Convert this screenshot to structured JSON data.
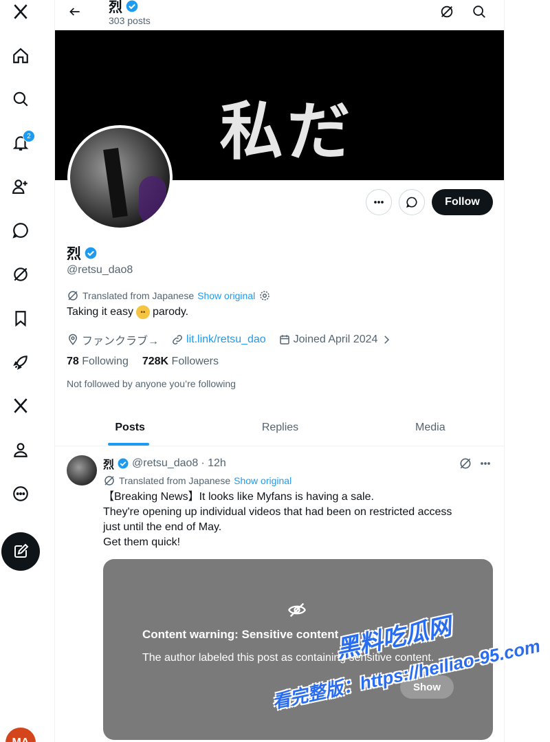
{
  "nav": {
    "notification_count": "2",
    "avatar_initials": "MA"
  },
  "header": {
    "name": "烈",
    "posts_count": "303 posts"
  },
  "banner": {
    "text": "私だ"
  },
  "profile": {
    "name": "烈",
    "handle": "@retsu_dao8",
    "translated_label": "Translated from Japanese",
    "show_original": "Show original",
    "bio_before": "Taking it easy",
    "bio_after": "parody.",
    "location": "ファンクラブ→",
    "website": "lit.link/retsu_dao",
    "joined": "Joined April 2024",
    "following_count": "78",
    "following_label": "Following",
    "followers_count": "728K",
    "followers_label": "Followers",
    "not_followed": "Not followed by anyone you’re following",
    "follow_button": "Follow"
  },
  "tabs": [
    {
      "label": "Posts"
    },
    {
      "label": "Replies"
    },
    {
      "label": "Media"
    }
  ],
  "post": {
    "name": "烈",
    "handle": "@retsu_dao8",
    "time": "· 12h",
    "translated_label": "Translated from Japanese",
    "show_original": "Show original",
    "lines": [
      "【Breaking News】It looks like Myfans is having a sale.",
      "They're opening up individual videos that had been on restricted access",
      "just until the end of May.",
      "Get them quick!"
    ],
    "content_warning_title": "Content warning: Sensitive content",
    "content_warning_desc": "The author labeled this post as containing sensitive content.",
    "show_button": "Show"
  },
  "watermark": {
    "line1": "黑料吃瓜网",
    "line2": "看完整版：https://heiliao-95.com"
  },
  "colors": {
    "accent": "#1d9bf0",
    "text": "#0f1419",
    "secondary": "#536471"
  }
}
